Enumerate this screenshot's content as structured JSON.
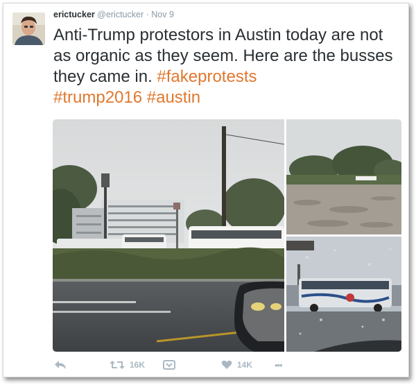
{
  "tweet": {
    "name": "erictucker",
    "handle": "@erictucker",
    "separator": "·",
    "date": "Nov 9",
    "text_parts": [
      "Anti-Trump protestors in Austin today are not as organic as they seem.  Here are the busses they came in. ",
      "#fakeprotests",
      "#trump2016",
      "#austin"
    ]
  },
  "media": {
    "photos": [
      "street-buses-photo",
      "field-photo",
      "bus-through-windshield-photo"
    ]
  },
  "actions": {
    "reply_icon": "reply-icon",
    "retweet_icon": "retweet-icon",
    "retweet_count": "16K",
    "save_icon": "save-icon",
    "like_icon": "heart-icon",
    "like_count": "14K",
    "more_icon": "more-icon",
    "more_label": "•••"
  },
  "colors": {
    "hashtag": "#e0782f",
    "text": "#292f33",
    "meta": "#8899a6",
    "action": "#aab8c2"
  }
}
